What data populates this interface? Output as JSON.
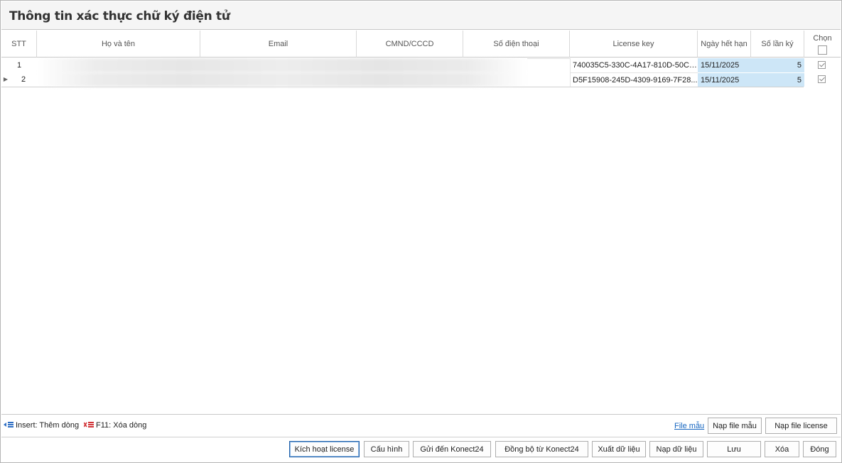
{
  "title": "Thông tin xác thực chữ ký điện tử",
  "columns": {
    "stt": "STT",
    "ho_va_ten": "Họ và tên",
    "email": "Email",
    "cmnd": "CMND/CCCD",
    "so_dien_thoai": "Số điện thoại",
    "license_key": "License key",
    "ngay_het_han": "Ngày hết hạn",
    "so_lan_ky": "Số lần ký",
    "chon": "Chọn"
  },
  "rows": [
    {
      "stt": "1",
      "license_key": "740035C5-330C-4A17-810D-50CB...",
      "ngay_het_han": "15/11/2025",
      "so_lan_ky": "5",
      "chon": true
    },
    {
      "stt": "2",
      "license_key": "D5F15908-245D-4309-9169-7F28...",
      "ngay_het_han": "15/11/2025",
      "so_lan_ky": "5",
      "chon": true
    }
  ],
  "hints": {
    "insert": "Insert: Thêm dòng",
    "delete": "F11: Xóa dòng"
  },
  "links": {
    "file_mau": "File mẫu"
  },
  "buttons": {
    "nap_file_mau": "Nạp file mẫu",
    "nap_file_license": "Nạp file license",
    "kich_hoat_license": "Kích hoạt license",
    "cau_hinh": "Cấu hình",
    "gui_den_konect24": "Gửi đến Konect24",
    "dong_bo_tu_konect24": "Đồng bộ từ Konect24",
    "xuat_du_lieu": "Xuất dữ liệu",
    "nap_du_lieu": "Nạp dữ liệu",
    "luu": "Lưu",
    "xoa": "Xóa",
    "dong": "Đóng"
  },
  "colors": {
    "highlight": "#cde6f7",
    "link": "#1565c0",
    "insert_icon": "#2f6fc4",
    "delete_icon": "#d13438"
  }
}
